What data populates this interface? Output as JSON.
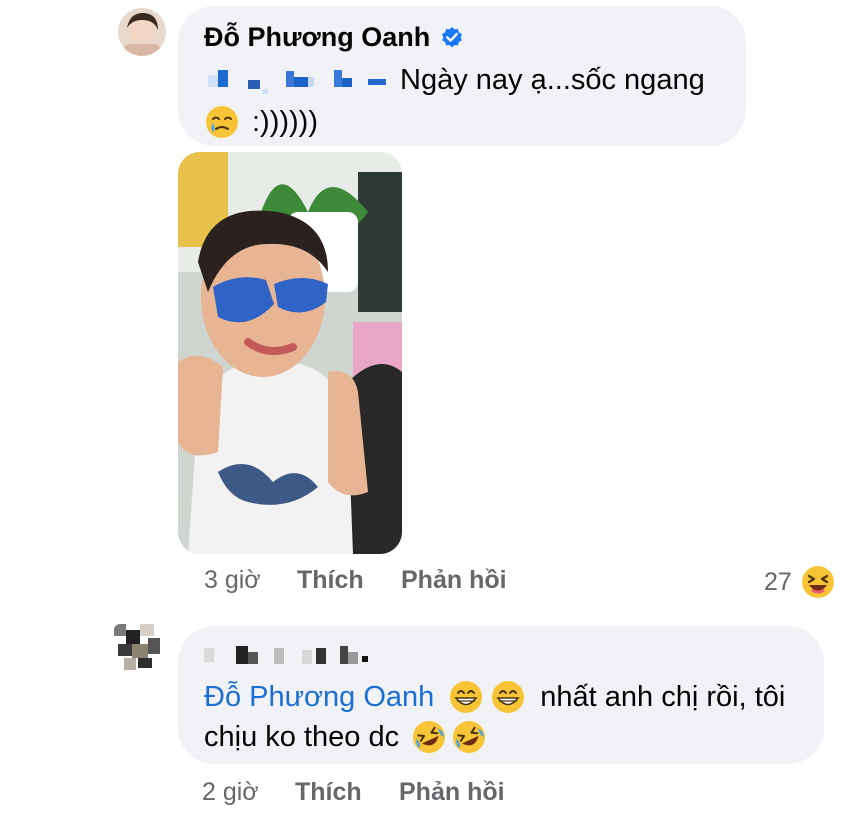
{
  "comments": [
    {
      "author": "Đỗ Phương Oanh",
      "verified": true,
      "text_line1": "Ngày nay ạ...sốc ngang",
      "text_line2": ":))))))",
      "time": "3 giờ",
      "like_label": "Thích",
      "reply_label": "Phản hồi",
      "reaction_count": "27",
      "reaction_icon": "haha-icon"
    },
    {
      "author_hidden": true,
      "mention": "Đỗ Phương Oanh",
      "text_line1_tail": "nhất anh chị rồi, tôi",
      "text_line2": "chịu ko theo dc",
      "time": "2 giờ",
      "like_label": "Thích",
      "reply_label": "Phản hồi"
    }
  ],
  "colors": {
    "bubble": "#f0f2f5",
    "mention": "#1c6fd2",
    "meta": "#65676b",
    "verified": "#1877f2"
  }
}
